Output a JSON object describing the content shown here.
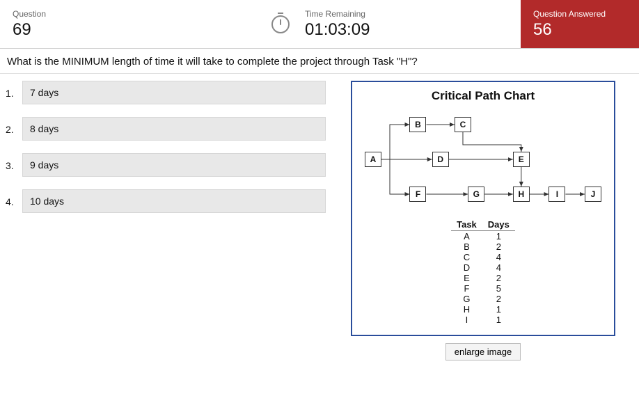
{
  "header": {
    "question_label": "Question",
    "question_number": "69",
    "time_label": "Time Remaining",
    "time_value": "01:03:09",
    "answered_label": "Question Answered",
    "answered_value": "56"
  },
  "question_text": "What is the MINIMUM length of time it will take to complete the project through Task \"H\"?",
  "answers": [
    {
      "num": "1.",
      "text": "7 days"
    },
    {
      "num": "2.",
      "text": "8 days"
    },
    {
      "num": "3.",
      "text": "9 days"
    },
    {
      "num": "4.",
      "text": "10 days"
    }
  ],
  "chart": {
    "title": "Critical Path Chart",
    "nodes": [
      "A",
      "B",
      "C",
      "D",
      "E",
      "F",
      "G",
      "H",
      "I",
      "J"
    ],
    "table_headers": {
      "task": "Task",
      "days": "Days"
    },
    "table": [
      {
        "task": "A",
        "days": "1"
      },
      {
        "task": "B",
        "days": "2"
      },
      {
        "task": "C",
        "days": "4"
      },
      {
        "task": "D",
        "days": "4"
      },
      {
        "task": "E",
        "days": "2"
      },
      {
        "task": "F",
        "days": "5"
      },
      {
        "task": "G",
        "days": "2"
      },
      {
        "task": "H",
        "days": "1"
      },
      {
        "task": "I",
        "days": "1"
      }
    ],
    "enlarge_label": "enlarge image"
  },
  "chart_data": {
    "type": "diagram",
    "title": "Critical Path Chart",
    "nodes": [
      {
        "id": "A",
        "x": 0,
        "y": 1
      },
      {
        "id": "B",
        "x": 1,
        "y": 0
      },
      {
        "id": "C",
        "x": 2,
        "y": 0
      },
      {
        "id": "D",
        "x": 1.5,
        "y": 1
      },
      {
        "id": "E",
        "x": 3.3,
        "y": 1
      },
      {
        "id": "F",
        "x": 1,
        "y": 2
      },
      {
        "id": "G",
        "x": 2.3,
        "y": 2
      },
      {
        "id": "H",
        "x": 3.3,
        "y": 2
      },
      {
        "id": "I",
        "x": 4.1,
        "y": 2
      },
      {
        "id": "J",
        "x": 4.9,
        "y": 2
      }
    ],
    "edges": [
      [
        "A",
        "B"
      ],
      [
        "B",
        "C"
      ],
      [
        "A",
        "D"
      ],
      [
        "A",
        "F"
      ],
      [
        "D",
        "E"
      ],
      [
        "C",
        "E"
      ],
      [
        "F",
        "G"
      ],
      [
        "G",
        "H"
      ],
      [
        "E",
        "H"
      ],
      [
        "H",
        "I"
      ],
      [
        "I",
        "J"
      ]
    ],
    "durations": {
      "A": 1,
      "B": 2,
      "C": 4,
      "D": 4,
      "E": 2,
      "F": 5,
      "G": 2,
      "H": 1,
      "I": 1
    }
  }
}
